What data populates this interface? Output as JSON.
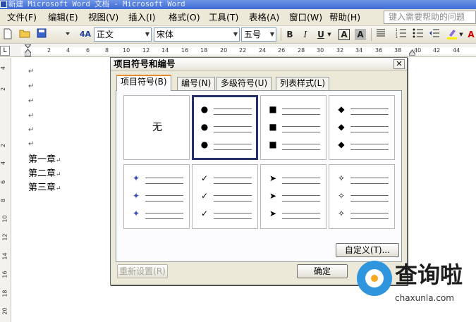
{
  "window": {
    "title": "新建 Microsoft Word 文档 - Microsoft Word"
  },
  "menu": {
    "items": [
      "文件(F)",
      "编辑(E)",
      "视图(V)",
      "插入(I)",
      "格式(O)",
      "工具(T)",
      "表格(A)",
      "窗口(W)",
      "帮助(H)"
    ],
    "help_placeholder": "键入需要帮助的问题"
  },
  "toolbar": {
    "style": "正文",
    "font": "宋体",
    "size": "五号",
    "style_icon": "4A",
    "bold": "B",
    "italic": "I",
    "underline": "U",
    "char_border": "A",
    "char_shading": "A"
  },
  "ruler": {
    "tab_selector": "L",
    "numbers": [
      "2",
      "4",
      "6",
      "8",
      "10",
      "12",
      "14",
      "16",
      "18",
      "20",
      "22",
      "24",
      "26",
      "28",
      "30",
      "32",
      "34",
      "36",
      "38",
      "40",
      "42",
      "44"
    ],
    "vertical_numbers": [
      "4",
      "2",
      "2",
      "4",
      "6",
      "8",
      "10",
      "12",
      "14",
      "16",
      "18",
      "20",
      "22"
    ]
  },
  "document": {
    "paragraph_mark": "↵",
    "lines": [
      "第一章",
      "第二章",
      "第三章"
    ]
  },
  "dialog": {
    "title": "项目符号和编号",
    "close": "✕",
    "tabs": [
      "项目符号(B)",
      "编号(N)",
      "多级符号(U)",
      "列表样式(L)"
    ],
    "none_label": "无",
    "bullets": [
      "●",
      "■",
      "◆",
      "✦",
      "✓",
      "➤",
      "✧"
    ],
    "customize": "自定义(T)...",
    "reset": "重新设置(R)",
    "ok": "确定"
  },
  "watermark": {
    "brand": "查询啦",
    "domain": "chaxunla.com"
  }
}
